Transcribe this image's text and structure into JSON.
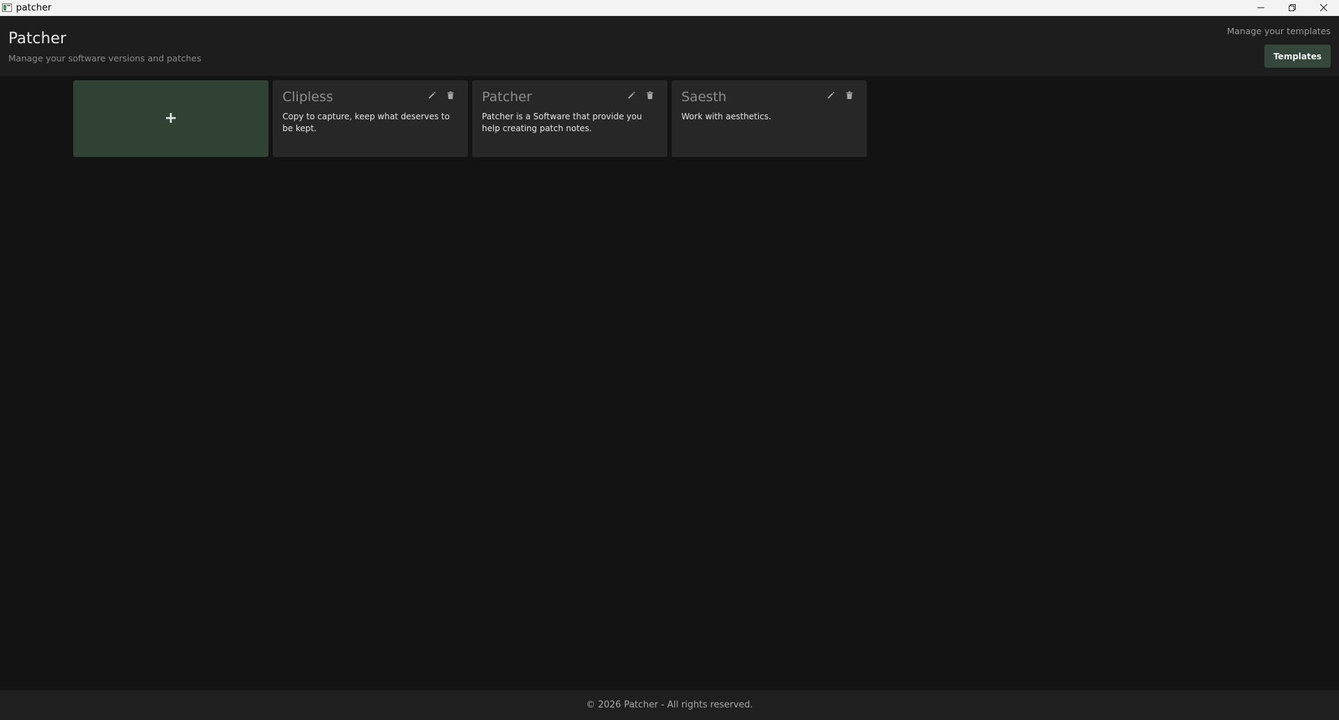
{
  "window": {
    "title": "patcher",
    "app_icon": "app-icon",
    "controls": [
      "minimize-icon",
      "restore-icon",
      "close-icon"
    ]
  },
  "header": {
    "title": "Patcher",
    "subtitle": "Manage your software versions and patches",
    "templates_hint": "Manage your templates",
    "templates_button": "Templates"
  },
  "cards": {
    "add_label": "+",
    "items": [
      {
        "name": "Clipless",
        "description": "Copy to capture, keep what deserves to be kept."
      },
      {
        "name": "Patcher",
        "description": "Patcher is a Software that provide you help creating patch notes."
      },
      {
        "name": "Saesth",
        "description": "Work with aesthetics."
      }
    ]
  },
  "footer": {
    "text": "© 2026 Patcher - All rights reserved."
  },
  "colors": {
    "background": "#131313",
    "header": "#1d1d1d",
    "card": "#272727",
    "accent": "#35473a",
    "add_card": "#2f4234"
  }
}
